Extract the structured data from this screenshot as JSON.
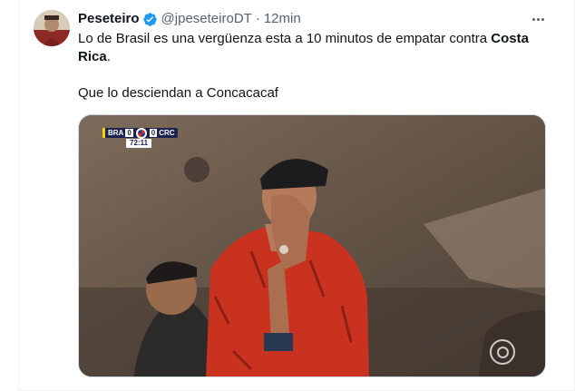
{
  "tweet": {
    "display_name": "Peseteiro",
    "handle": "@jpeseteiroDT",
    "separator": "·",
    "time": "12min",
    "text_line1_prefix": "Lo de Brasil es una vergüenza esta a 10 minutos de empatar contra ",
    "text_line1_bold": "Costa",
    "text_line2_bold": "Rica",
    "text_line2_suffix": ".",
    "text_line3": "Que lo desciendan a Concacacaf"
  },
  "media": {
    "scoreboard": {
      "home_team": "BRA",
      "home_score": "0",
      "away_score": "0",
      "away_team": "CRC",
      "clock": "72:11"
    },
    "broadcaster_icon": "globo-logo-icon"
  },
  "icons": {
    "verified": "verified-badge-icon",
    "more": "more-options-icon"
  },
  "colors": {
    "verified_blue": "#1d9bf0",
    "secondary_text": "#536471",
    "primary_text": "#0f1419"
  }
}
